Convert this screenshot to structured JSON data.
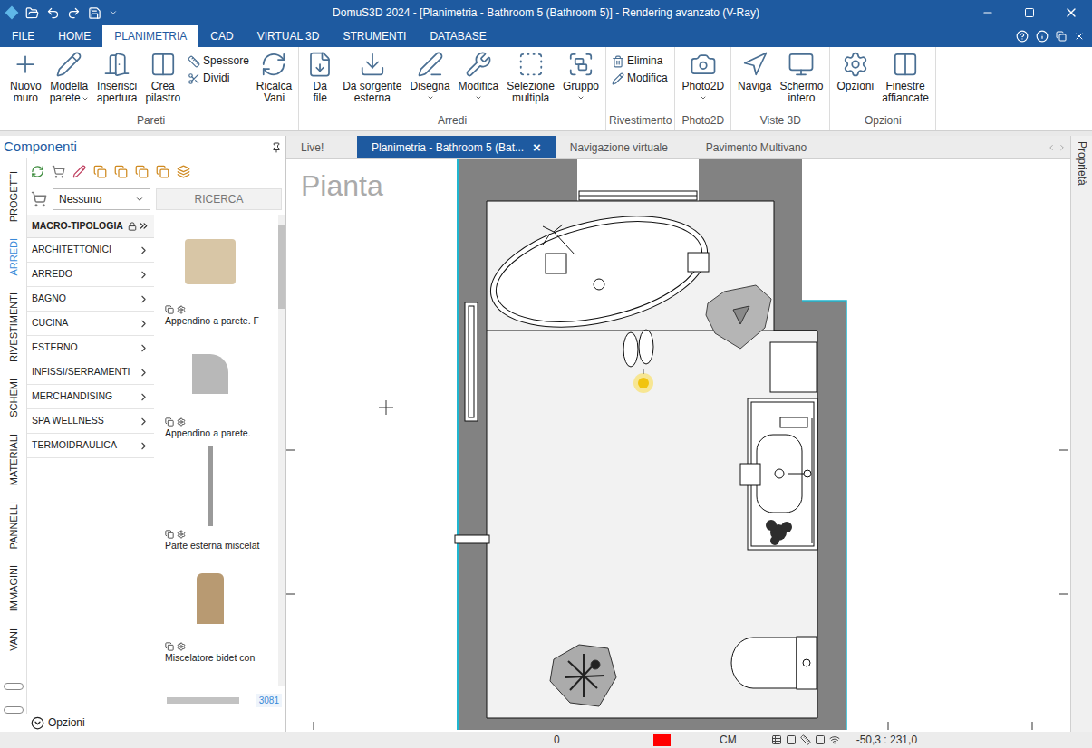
{
  "window": {
    "title": "DomuS3D 2024 - [Planimetria - Bathroom 5 (Bathroom 5)] - Rendering avanzato (V-Ray)"
  },
  "menu_tabs": [
    {
      "label": "FILE",
      "selected": false
    },
    {
      "label": "HOME",
      "selected": false
    },
    {
      "label": "PLANIMETRIA",
      "selected": true
    },
    {
      "label": "CAD",
      "selected": false
    },
    {
      "label": "VIRTUAL 3D",
      "selected": false
    },
    {
      "label": "STRUMENTI",
      "selected": false
    },
    {
      "label": "DATABASE",
      "selected": false
    }
  ],
  "ribbon_groups": [
    {
      "label": "Pareti",
      "buttons": [
        {
          "kind": "large",
          "lines": [
            "Nuovo",
            "muro"
          ],
          "dropdown": false
        },
        {
          "kind": "large",
          "lines": [
            "Modella",
            "parete"
          ],
          "dropdown": true
        },
        {
          "kind": "large",
          "lines": [
            "Inserisci",
            "apertura"
          ],
          "dropdown": false
        },
        {
          "kind": "large",
          "lines": [
            "Crea",
            "pilastro"
          ],
          "dropdown": false
        },
        {
          "kind": "stack",
          "items": [
            {
              "label": "Spessore"
            },
            {
              "label": "Dividi"
            }
          ]
        },
        {
          "kind": "large",
          "lines": [
            "Ricalca",
            "Vani"
          ],
          "dropdown": false
        }
      ]
    },
    {
      "label": "Arredi",
      "buttons": [
        {
          "kind": "large",
          "lines": [
            "Da",
            "file"
          ],
          "dropdown": false
        },
        {
          "kind": "large",
          "lines": [
            "Da sorgente",
            "esterna"
          ],
          "dropdown": false
        },
        {
          "kind": "large",
          "lines": [
            "Disegna"
          ],
          "dropdown": true
        },
        {
          "kind": "large",
          "lines": [
            "Modifica"
          ],
          "dropdown": true
        },
        {
          "kind": "large",
          "lines": [
            "Selezione",
            "multipla"
          ],
          "dropdown": false
        },
        {
          "kind": "large",
          "lines": [
            "Gruppo"
          ],
          "dropdown": true
        }
      ]
    },
    {
      "label": "Rivestimento",
      "buttons": [
        {
          "kind": "stack",
          "items": [
            {
              "label": "Elimina"
            },
            {
              "label": "Modifica"
            }
          ]
        }
      ]
    },
    {
      "label": "Photo2D",
      "buttons": [
        {
          "kind": "large",
          "lines": [
            "Photo2D"
          ],
          "dropdown": true
        }
      ]
    },
    {
      "label": "Viste 3D",
      "buttons": [
        {
          "kind": "large",
          "lines": [
            "Naviga"
          ],
          "dropdown": false
        },
        {
          "kind": "large",
          "lines": [
            "Schermo",
            "intero"
          ],
          "dropdown": false
        }
      ]
    },
    {
      "label": "Opzioni",
      "buttons": [
        {
          "kind": "large",
          "lines": [
            "Opzioni"
          ],
          "dropdown": false
        },
        {
          "kind": "large",
          "lines": [
            "Finestre",
            "affiancate"
          ],
          "dropdown": false
        }
      ]
    }
  ],
  "components_panel": {
    "title": "Componenti",
    "side_tabs": [
      {
        "label": "PROGETTI",
        "selected": false
      },
      {
        "label": "ARREDI",
        "selected": true
      },
      {
        "label": "RIVESTIMENTI",
        "selected": false
      },
      {
        "label": "SCHEMI",
        "selected": false
      },
      {
        "label": "MATERIALI",
        "selected": false
      },
      {
        "label": "PANNELLI",
        "selected": false
      },
      {
        "label": "IMMAGINI",
        "selected": false
      },
      {
        "label": "VANI",
        "selected": false
      }
    ],
    "filter": {
      "value": "Nessuno"
    },
    "search_button": "RICERCA",
    "categories_header": "MACRO-TIPOLOGIA",
    "categories": [
      "ARCHITETTONICI",
      "ARREDO",
      "BAGNO",
      "CUCINA",
      "ESTERNO",
      "INFISSI/SERRAMENTI",
      "MERCHANDISING",
      "SPA WELLNESS",
      "TERMOIDRAULICA"
    ],
    "items": [
      {
        "label": "Appendino a parete. F"
      },
      {
        "label": "Appendino a parete."
      },
      {
        "label": "Parte esterna miscelat"
      },
      {
        "label": "Miscelatore bidet con"
      }
    ],
    "count": "3081",
    "options": "Opzioni"
  },
  "doc_tabs": [
    {
      "label": "Live!",
      "selected": false,
      "close": ""
    },
    {
      "label": "Planimetria - Bathroom 5 (Bat...",
      "selected": true,
      "close": "×"
    },
    {
      "label": "Navigazione virtuale",
      "selected": false,
      "close": ""
    },
    {
      "label": "Pavimento Multivano",
      "selected": false,
      "close": ""
    }
  ],
  "canvas": {
    "view_label": "Pianta"
  },
  "properties_label": "Proprietà",
  "status_bar": {
    "value": "0",
    "units": "CM",
    "coordinates": "-50,3 : 231,0"
  }
}
